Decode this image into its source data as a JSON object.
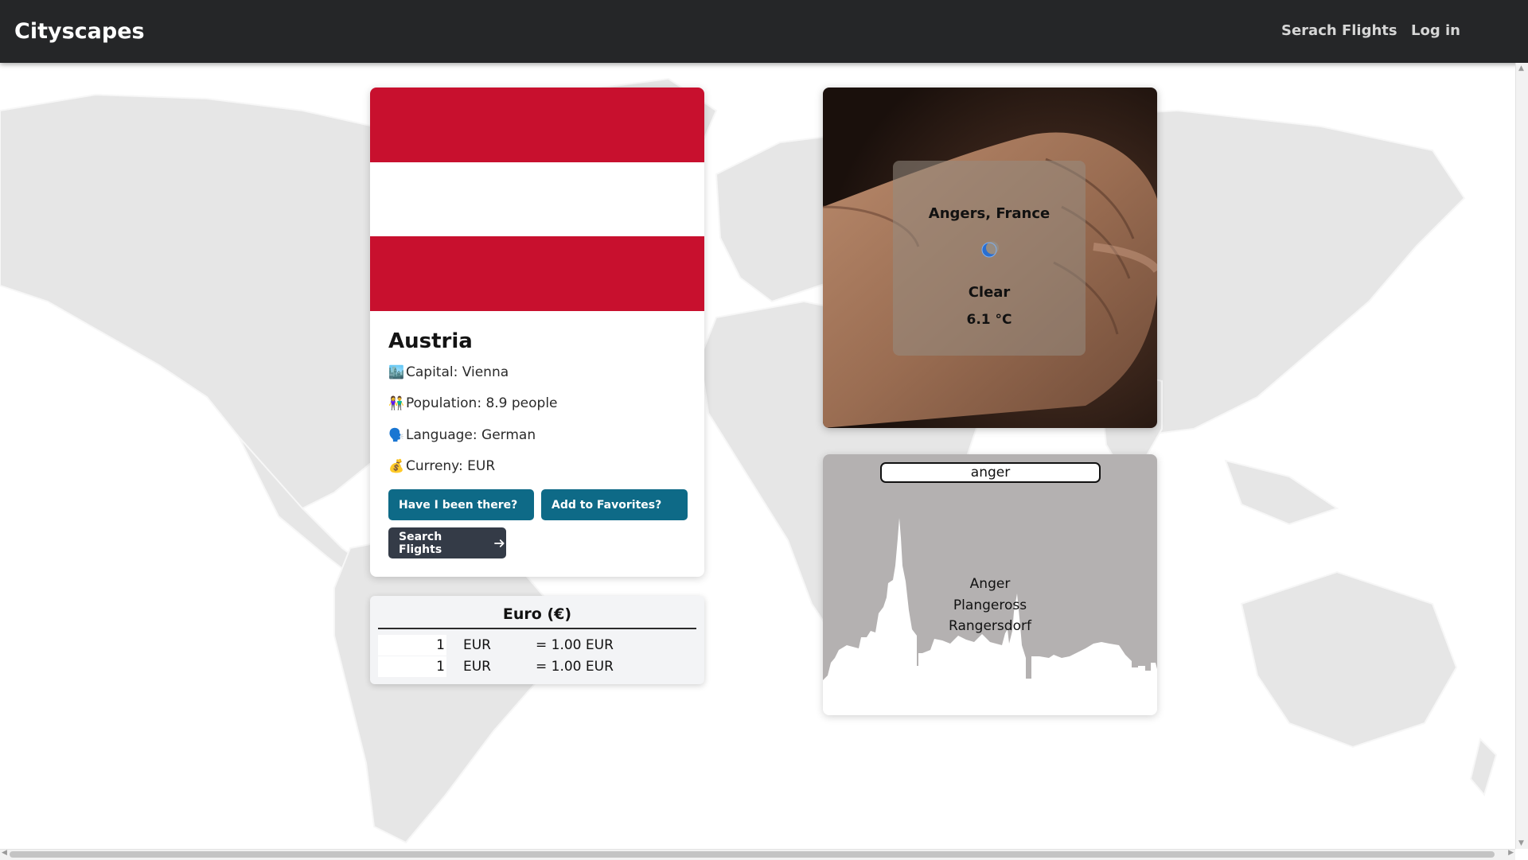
{
  "nav": {
    "brand": "Cityscapes",
    "links": [
      "Serach Flights",
      "Log in"
    ]
  },
  "country": {
    "name": "Austria",
    "flag_colors": [
      "#c8102e",
      "#ffffff",
      "#c8102e"
    ],
    "info": [
      {
        "icon": "cityscape-icon",
        "emoji": "🏙️",
        "text": "Capital: Vienna"
      },
      {
        "icon": "people-icon",
        "emoji": "👫",
        "text": "Population: 8.9 people"
      },
      {
        "icon": "speaking-head-icon",
        "emoji": "🗣️",
        "text": "Language: German"
      },
      {
        "icon": "money-bag-icon",
        "emoji": "💰",
        "text": "Curreny: EUR"
      }
    ],
    "buttons": {
      "been_there": "Have I been there?",
      "favorites": "Add to Favorites?",
      "search_flights": "Search Flights"
    }
  },
  "currency": {
    "title": "Euro (€)",
    "rows": [
      {
        "amount": "1",
        "code": "EUR",
        "result": "= 1.00 EUR"
      },
      {
        "amount": "1",
        "code": "EUR",
        "result": "= 1.00 EUR"
      }
    ]
  },
  "weather": {
    "city": "Angers, France",
    "icon": "crescent-moon-icon",
    "condition": "Clear",
    "temperature": "6.1 °C"
  },
  "search": {
    "value": "anger",
    "results": [
      "Anger",
      "Plangeross",
      "Rangersdorf"
    ]
  },
  "colors": {
    "navbar": "#252628",
    "button_teal": "#0e6a87",
    "button_dark": "#343b47",
    "skyline": "#b4b1b1"
  }
}
